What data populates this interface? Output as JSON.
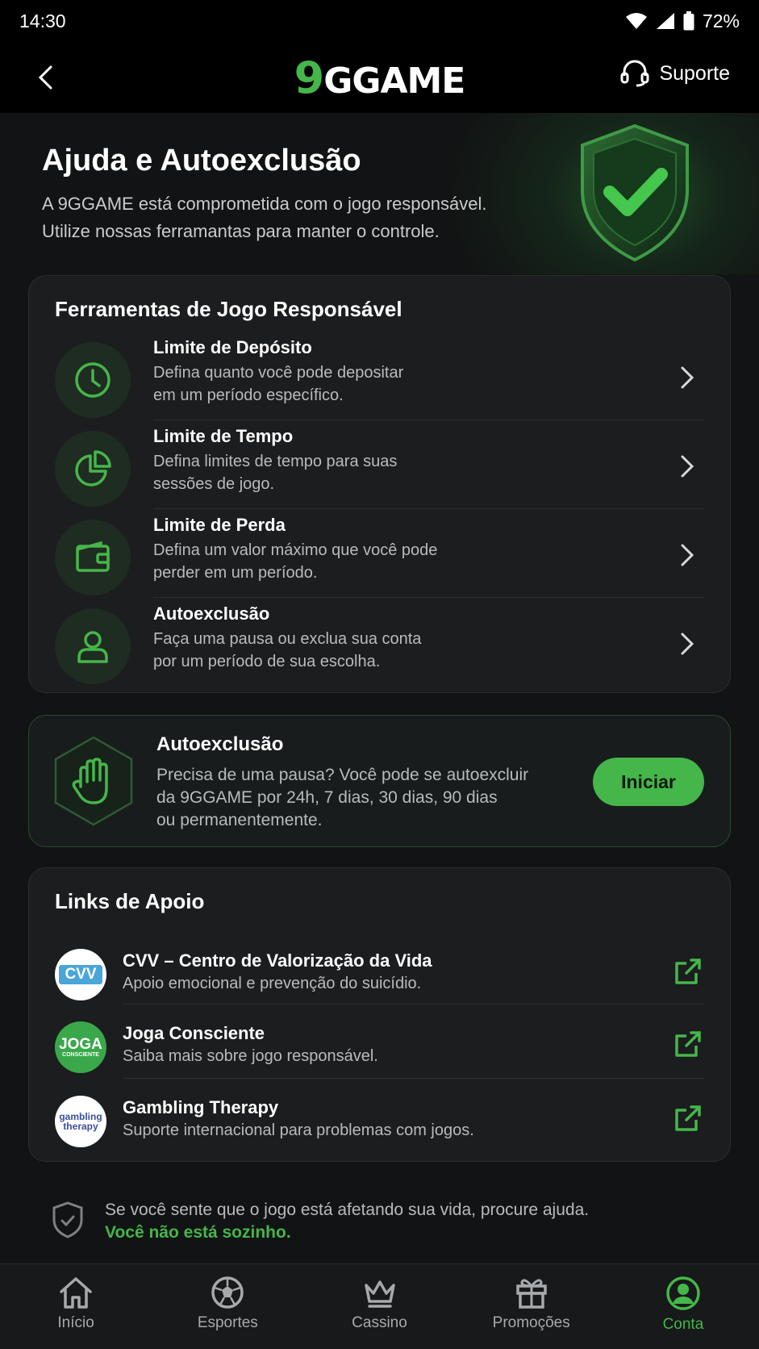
{
  "status_bar": {
    "time": "14:30",
    "battery": "72%"
  },
  "header": {
    "logo_nine": "9",
    "logo_rest": "GGAME",
    "support_label": "Suporte"
  },
  "hero": {
    "title": "Ajuda e Autoexclusão",
    "line1": "A 9GGAME está comprometida com o jogo responsável.",
    "line2": "Utilize nossas ferramantas para manter o controle."
  },
  "tools": {
    "title": "Ferramentas de Jogo Responsável",
    "items": [
      {
        "title": "Limite de Depósito",
        "desc1": "Defina quanto você pode depositar",
        "desc2": "em um período específico.",
        "icon": "clock-icon"
      },
      {
        "title": "Limite de Tempo",
        "desc1": "Defina limites de tempo para suas",
        "desc2": "sessões de jogo.",
        "icon": "pie-chart-icon"
      },
      {
        "title": "Limite de Perda",
        "desc1": "Defina um valor máximo que você pode",
        "desc2": "perder em um período.",
        "icon": "wallet-icon"
      },
      {
        "title": "Autoexclusão",
        "desc1": "Faça uma pausa ou exclua sua conta",
        "desc2": "por um período de sua escolha.",
        "icon": "user-icon"
      }
    ]
  },
  "auto_exclusion": {
    "title": "Autoexclusão",
    "line1": "Precisa de uma pausa? Você pode se autoexcluir",
    "line2": "da 9GGAME por 24h, 7 dias, 30 dias, 90 dias",
    "line3": "ou permanentemente.",
    "button": "Iniciar"
  },
  "support_links": {
    "title": "Links de Apoio",
    "items": [
      {
        "title": "CVV – Centro de Valorização da Vida",
        "desc": "Apoio emocional e prevenção do suicídio.",
        "logo_text": "CVV"
      },
      {
        "title": "Joga Consciente",
        "desc": "Saiba mais sobre jogo responsável.",
        "logo_text": "JOGA",
        "logo_sub": "CONSCIENTE"
      },
      {
        "title": "Gambling Therapy",
        "desc": "Suporte internacional para problemas com jogos.",
        "logo_text": "gambling",
        "logo_sub": "therapy"
      }
    ]
  },
  "note": {
    "text": "Se você sente que o jogo está afetando sua vida, procure ajuda.",
    "strong": "Você não está sozinho."
  },
  "nav": {
    "items": [
      {
        "label": "Início",
        "icon": "home-icon"
      },
      {
        "label": "Esportes",
        "icon": "soccer-ball-icon"
      },
      {
        "label": "Cassino",
        "icon": "crown-icon"
      },
      {
        "label": "Promoções",
        "icon": "gift-icon"
      },
      {
        "label": "Conta",
        "icon": "account-icon"
      }
    ],
    "active": "Conta"
  },
  "colors": {
    "accent": "#45b649",
    "background": "#121314",
    "card": "#1b1d1f"
  }
}
